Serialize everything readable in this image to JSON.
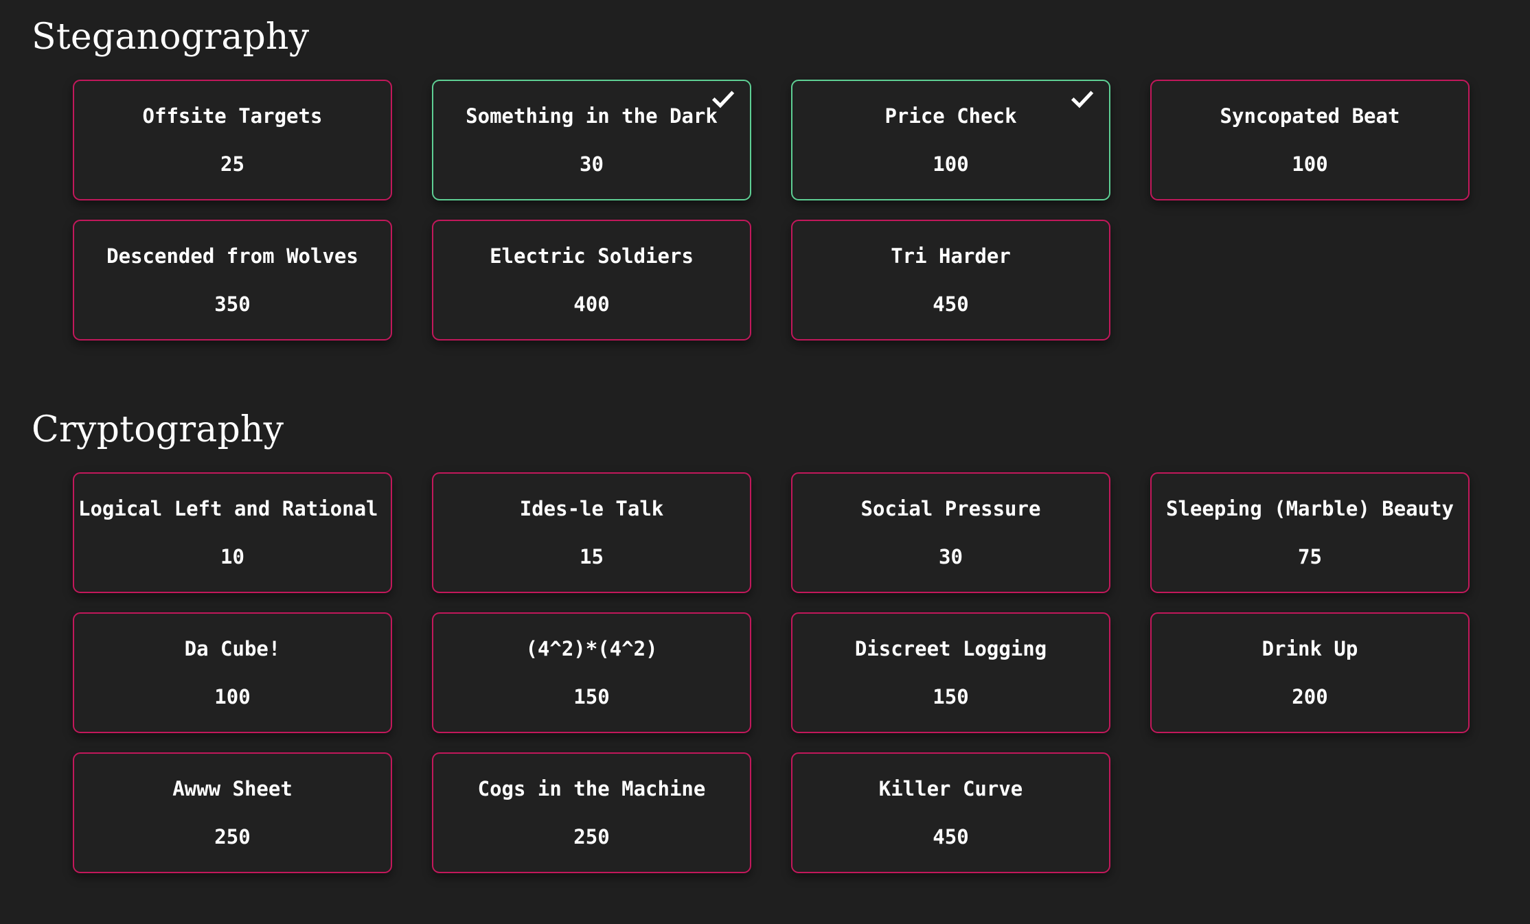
{
  "theme": {
    "background": "#1f1f1f",
    "card_background": "#212121",
    "unsolved_border": "#c2185b",
    "solved_border": "#5ecf94",
    "text": "#ffffff"
  },
  "sections": [
    {
      "id": "steganography",
      "title": "Steganography",
      "challenges": [
        {
          "name": "Offsite Targets",
          "points": "25",
          "solved": false
        },
        {
          "name": "Something in the Dark",
          "points": "30",
          "solved": true
        },
        {
          "name": "Price Check",
          "points": "100",
          "solved": true
        },
        {
          "name": "Syncopated Beat",
          "points": "100",
          "solved": false
        },
        {
          "name": "Descended from Wolves",
          "points": "350",
          "solved": false
        },
        {
          "name": "Electric Soldiers",
          "points": "400",
          "solved": false
        },
        {
          "name": "Tri Harder",
          "points": "450",
          "solved": false
        }
      ]
    },
    {
      "id": "cryptography",
      "title": "Cryptography",
      "challenges": [
        {
          "name": "Logical Left and Rational Right",
          "points": "10",
          "solved": false
        },
        {
          "name": "Ides-le Talk",
          "points": "15",
          "solved": false
        },
        {
          "name": "Social Pressure",
          "points": "30",
          "solved": false
        },
        {
          "name": "Sleeping (Marble) Beauty",
          "points": "75",
          "solved": false
        },
        {
          "name": "Da Cube!",
          "points": "100",
          "solved": false
        },
        {
          "name": "(4^2)*(4^2)",
          "points": "150",
          "solved": false
        },
        {
          "name": "Discreet Logging",
          "points": "150",
          "solved": false
        },
        {
          "name": "Drink Up",
          "points": "200",
          "solved": false
        },
        {
          "name": "Awww Sheet",
          "points": "250",
          "solved": false
        },
        {
          "name": "Cogs in the Machine",
          "points": "250",
          "solved": false
        },
        {
          "name": "Killer Curve",
          "points": "450",
          "solved": false
        }
      ]
    }
  ],
  "icons": {
    "solved_check": "check-icon"
  }
}
